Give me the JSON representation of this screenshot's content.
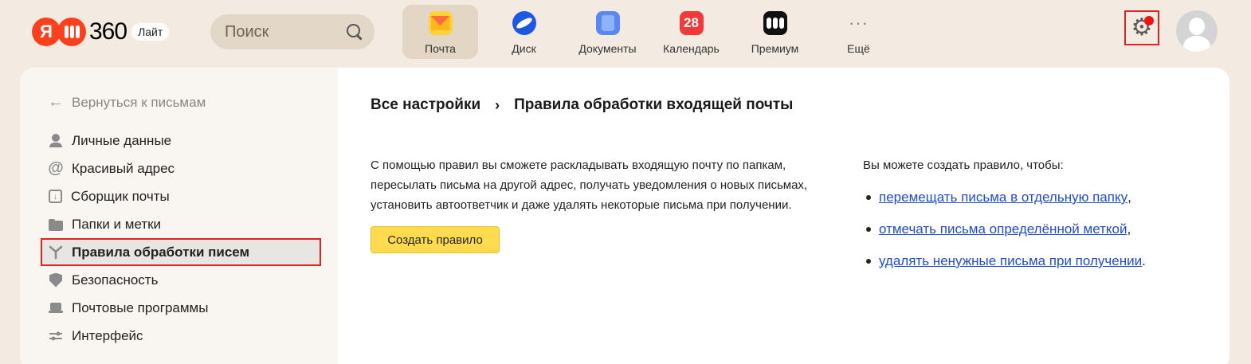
{
  "header": {
    "logo_ya": "Я",
    "logo_text": "360",
    "logo_badge": "Лайт",
    "search_placeholder": "Поиск",
    "apps": [
      {
        "label": "Почта",
        "icon": "mail-icon",
        "active": true
      },
      {
        "label": "Диск",
        "icon": "disk-icon"
      },
      {
        "label": "Документы",
        "icon": "docs-icon"
      },
      {
        "label": "Календарь",
        "icon": "calendar-icon",
        "badge": "28"
      },
      {
        "label": "Премиум",
        "icon": "premium-icon"
      },
      {
        "label": "Ещё",
        "icon": "more-icon",
        "glyph": "···"
      }
    ],
    "settings_icon": "gear-icon",
    "notification_color": "#f01414"
  },
  "sidebar": {
    "back_label": "Вернуться к письмам",
    "items": [
      {
        "label": "Личные данные",
        "icon": "person-icon"
      },
      {
        "label": "Красивый адрес",
        "icon": "at-icon"
      },
      {
        "label": "Сборщик почты",
        "icon": "inbox-download-icon"
      },
      {
        "label": "Папки и метки",
        "icon": "folder-icon"
      },
      {
        "label": "Правила обработки писем",
        "icon": "rules-fork-icon",
        "active": true
      },
      {
        "label": "Безопасность",
        "icon": "shield-icon"
      },
      {
        "label": "Почтовые программы",
        "icon": "laptop-icon"
      },
      {
        "label": "Интерфейс",
        "icon": "sliders-icon"
      }
    ]
  },
  "content": {
    "breadcrumb_root": "Все настройки",
    "breadcrumb_sep": "›",
    "breadcrumb_current": "Правила обработки входящей почты",
    "description": "С помощью правил вы сможете раскладывать входящую почту по папкам, пересылать письма на другой адрес, получать уведомления о новых письмах, установить автоответчик и даже удалять некоторые письма при получении.",
    "create_button": "Создать правило",
    "right_intro": "Вы можете создать правило, чтобы:",
    "links": [
      {
        "text": "перемещать письма в отдельную папку",
        "tail": ","
      },
      {
        "text": "отмечать письма определённой меткой",
        "tail": ","
      },
      {
        "text": "удалять ненужные письма при получении",
        "tail": "."
      }
    ]
  },
  "colors": {
    "accent_button": "#ffdb4d",
    "link": "#1f4dcc",
    "highlight_border": "#e02424",
    "background": "#f3ebe1"
  }
}
